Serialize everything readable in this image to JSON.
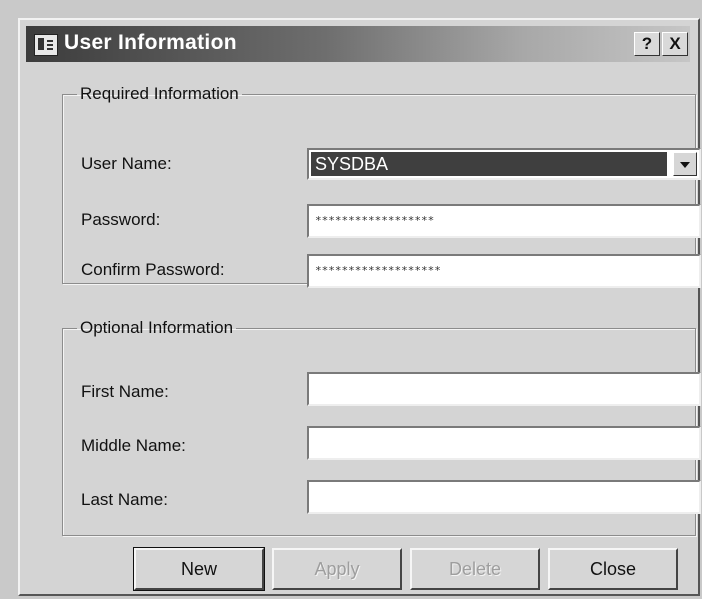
{
  "window": {
    "title": "User Information",
    "help_label": "?",
    "close_label": "X"
  },
  "required": {
    "legend": "Required Information",
    "user_name_label": "User Name:",
    "user_name_value": "SYSDBA",
    "password_label": "Password:",
    "password_value": "******************",
    "confirm_label": "Confirm Password:",
    "confirm_value": "*******************"
  },
  "optional": {
    "legend": "Optional Information",
    "first_name_label": "First Name:",
    "first_name_value": "",
    "middle_name_label": "Middle Name:",
    "middle_name_value": "",
    "last_name_label": "Last Name:",
    "last_name_value": ""
  },
  "buttons": {
    "new": "New",
    "apply": "Apply",
    "delete": "Delete",
    "close": "Close"
  },
  "colors": {
    "title_gradient_start": "#3c3c3c",
    "title_gradient_end": "#c6c6c6",
    "dialog_face": "#d4d4d4",
    "selected_value_bg": "#3f3f3f"
  },
  "icons": [
    "window-app-icon",
    "help-icon",
    "close-icon",
    "chevron-down-icon"
  ]
}
